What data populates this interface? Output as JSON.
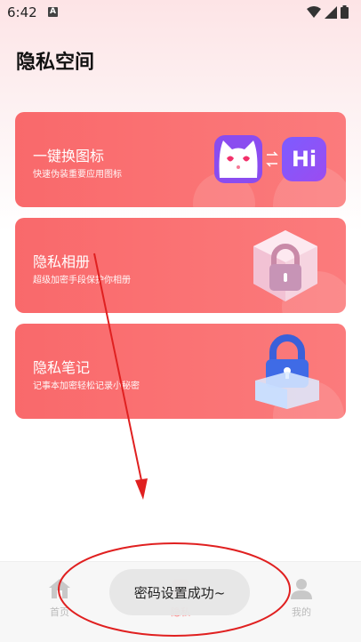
{
  "status_bar": {
    "time": "6:42",
    "notification_letter": "A",
    "icons": [
      "wifi-icon",
      "signal-icon",
      "battery-icon"
    ]
  },
  "header": {
    "title": "隐私空间"
  },
  "cards": [
    {
      "title": "一键换图标",
      "subtitle": "快速伪装重要应用图标",
      "icon": "cat-app-icon",
      "icon2": "hi-app-icon",
      "icon2_text": "Hi"
    },
    {
      "title": "隐私相册",
      "subtitle": "超级加密手段保护你相册",
      "icon": "lock-cube-icon"
    },
    {
      "title": "隐私笔记",
      "subtitle": "记事本加密轻松记录小秘密",
      "icon": "lock-box-icon"
    }
  ],
  "bottom_nav": [
    {
      "label": "首页",
      "icon": "home-icon",
      "active": false
    },
    {
      "label": "隐私",
      "icon": "privacy-icon",
      "active": true
    },
    {
      "label": "我的",
      "icon": "profile-icon",
      "active": false
    }
  ],
  "toast": {
    "text": "密码设置成功~"
  },
  "colors": {
    "card": "#f9696b",
    "accent": "#ff6666",
    "annotation": "#e02020"
  }
}
